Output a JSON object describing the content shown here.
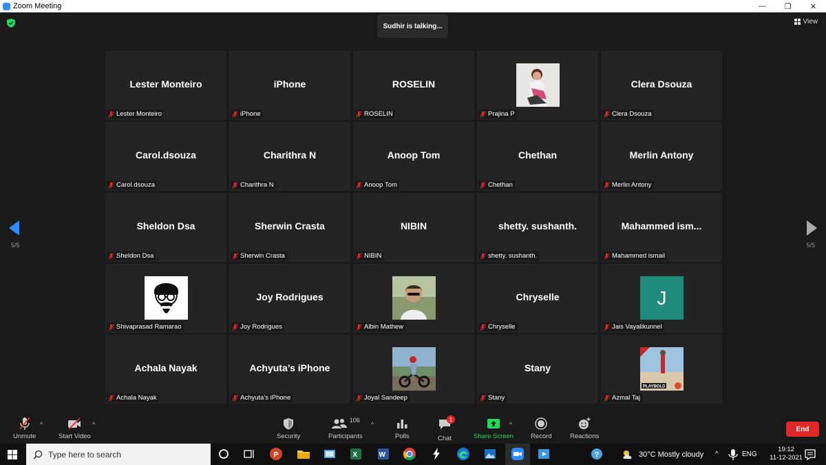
{
  "window": {
    "title": "Zoom Meeting",
    "minimize": "—",
    "maximize": "❐",
    "close": "✕"
  },
  "header": {
    "talking": "Sudhir is talking...",
    "view_label": "View"
  },
  "pagination": {
    "left": "5/5",
    "right": "5/5"
  },
  "participants": [
    {
      "big": "Lester Monteiro",
      "caption": "Lester Monteiro"
    },
    {
      "big": "iPhone",
      "caption": "iPhone"
    },
    {
      "big": "ROSELIN",
      "caption": "ROSELIN"
    },
    {
      "big": "",
      "caption": "Prajina P",
      "avatar": "photo-girl"
    },
    {
      "big": "Clera Dsouza",
      "caption": "Clera Dsouza"
    },
    {
      "big": "Carol.dsouza",
      "caption": "Carol.dsouza"
    },
    {
      "big": "Charithra N",
      "caption": "Charithra N"
    },
    {
      "big": "Anoop Tom",
      "caption": "Anoop Tom"
    },
    {
      "big": "Chethan",
      "caption": "Chethan"
    },
    {
      "big": "Merlin Antony",
      "caption": "Merlin Antony"
    },
    {
      "big": "Sheldon Dsa",
      "caption": "Sheldon Dsa"
    },
    {
      "big": "Sherwin Crasta",
      "caption": "Sherwin Crasta"
    },
    {
      "big": "NIBIN",
      "caption": "NIBIN"
    },
    {
      "big": "shetty. sushanth.",
      "caption": "shetty. sushanth."
    },
    {
      "big": "Mahammed  ism...",
      "caption": "Mahammed ismail"
    },
    {
      "big": "",
      "caption": "Shivaprasad Ramarao",
      "avatar": "cartoon-face"
    },
    {
      "big": "Joy Rodrigues",
      "caption": "Joy Rodrigues"
    },
    {
      "big": "",
      "caption": "Albin Mathew",
      "avatar": "photo-man"
    },
    {
      "big": "Chryselle",
      "caption": "Chryselle"
    },
    {
      "big": "",
      "caption": "Jais Vayalikunnel",
      "avatar": "letter-J",
      "letter": "J"
    },
    {
      "big": "Achala Nayak",
      "caption": "Achala Nayak"
    },
    {
      "big": "Achyuta’s iPhone",
      "caption": "Achyuta’s iPhone"
    },
    {
      "big": "",
      "caption": "Joyal Sandeep",
      "avatar": "photo-bike"
    },
    {
      "big": "Stany",
      "caption": "Stany"
    },
    {
      "big": "",
      "caption": "Azmal Taj",
      "avatar": "photo-beach",
      "avatar_text": "PLAYBOLD"
    }
  ],
  "toolbar": {
    "unmute": "Unmute",
    "start_video": "Start Video",
    "security": "Security",
    "participants": "Participants",
    "participants_count": "106",
    "polls": "Polls",
    "chat": "Chat",
    "chat_badge": "1",
    "share_screen": "Share Screen",
    "record": "Record",
    "reactions": "Reactions",
    "end": "End"
  },
  "taskbar": {
    "search_placeholder": "Type here to search",
    "weather": "30°C  Mostly cloudy",
    "lang": "ENG",
    "time": "19:12",
    "date": "11-12-2021"
  },
  "colors": {
    "share_green": "#23d959",
    "end_red": "#e02828",
    "zoom_blue": "#2d8cff",
    "tile_bg": "#242424",
    "jais_teal": "#1f8c7e"
  }
}
